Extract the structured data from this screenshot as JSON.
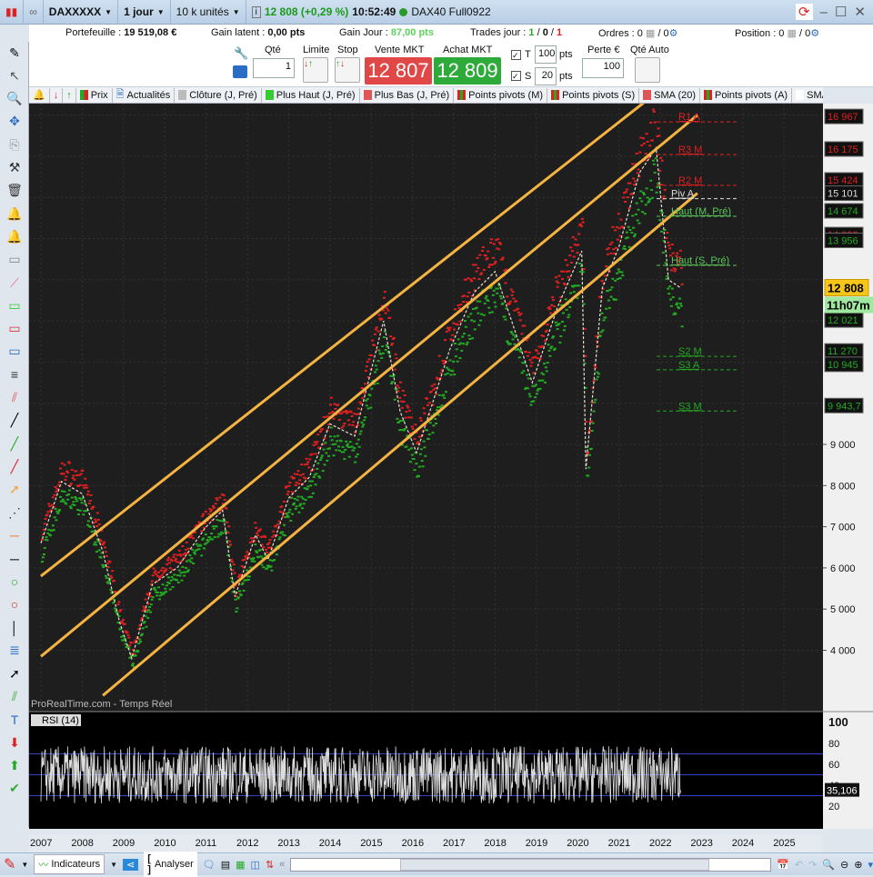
{
  "titlebar": {
    "symbol": "DAXXXXX",
    "period": "1 jour",
    "units": "10 k unités",
    "quote": "12 808 (+0,29 %)",
    "time": "10:52:49",
    "instrument": "DAX40 Full0922"
  },
  "infobar": {
    "portefeuille_label": "Portefeuille :",
    "portefeuille": "19 519,08 €",
    "gain_latent_label": "Gain latent :",
    "gain_latent": "0,00 pts",
    "gain_jour_label": "Gain Jour :",
    "gain_jour": "87,00 pts",
    "trades_label": "Trades jour :",
    "trades_a": "1",
    "trades_b": "0",
    "trades_c": "1",
    "ordres_label": "Ordres : 0",
    "ordres_b": "/ 0",
    "position_label": "Position : 0",
    "position_b": "/ 0"
  },
  "trade": {
    "qte_label": "Qté",
    "qte": "1",
    "limite_label": "Limite",
    "stop_label": "Stop",
    "vente_label": "Vente MKT",
    "vente": "12 807",
    "achat_label": "Achat MKT",
    "achat": "12 809",
    "t_label": "T",
    "t_value": "100",
    "s_label": "S",
    "s_value": "20",
    "pts": "pts",
    "perte_label": "Perte €",
    "perte": "100",
    "qte_auto_label": "Qté Auto"
  },
  "legend": [
    "Prix",
    "Actualités",
    "Clôture (J, Pré)",
    "Plus Haut (J, Pré)",
    "Plus Bas (J, Pré)",
    "Points pivots (M)",
    "Points pivots (S)",
    "SMA (20)",
    "Points pivots (A)",
    "SMA ("
  ],
  "colors": {
    "up": "#22aa22",
    "down": "#e02020",
    "channel": "#f5b342",
    "background": "#1e1e1e",
    "vente": "#e04848",
    "achat": "#2eaa3a"
  },
  "chart": {
    "watermark": "ProRealTime.com - Temps Réel",
    "pivot_labels": [
      {
        "t": "R1 A",
        "p": 16967,
        "c": "#e02020"
      },
      {
        "t": "R3 M",
        "p": 16175,
        "c": "#e02020"
      },
      {
        "t": "R2 M",
        "p": 15424,
        "c": "#e02020"
      },
      {
        "t": "Piv A",
        "p": 15101,
        "c": "#dddddd"
      },
      {
        "t": "Haut (M, Pré)",
        "p": 14674,
        "c": "#5ac85a"
      },
      {
        "t": "Haut (S, Pré)",
        "p": 13480,
        "c": "#5ac85a"
      },
      {
        "t": "S2 M",
        "p": 11270,
        "c": "#22aa22"
      },
      {
        "t": "S3 A",
        "p": 10945,
        "c": "#22aa22"
      },
      {
        "t": "S3 M",
        "p": 9943.7,
        "c": "#22aa22"
      }
    ],
    "price_tags": [
      {
        "t": "16 967",
        "c": "#e02020"
      },
      {
        "t": "16 175",
        "c": "#e02020"
      },
      {
        "t": "15 424",
        "c": "#e02020"
      },
      {
        "t": "15 101",
        "c": "#dddddd"
      },
      {
        "t": "14 674",
        "c": "#22aa22"
      },
      {
        "t": "14 098",
        "c": "#e02020"
      },
      {
        "t": "13 956",
        "c": "#22aa22"
      },
      {
        "t": "12 021",
        "c": "#22aa22"
      },
      {
        "t": "11 270",
        "c": "#22aa22"
      },
      {
        "t": "10 945",
        "c": "#22aa22"
      },
      {
        "t": "9 943,7",
        "c": "#22aa22"
      }
    ],
    "last_price": "12 808",
    "countdown": "11h07m",
    "rsi_label": "RSI (14)",
    "rsi_value": "35,106"
  },
  "chart_data": {
    "type": "line",
    "ylim": [
      3000,
      17500
    ],
    "yticks": [
      "4 000",
      "5 000",
      "6 000",
      "7 000",
      "8 000",
      "9 000"
    ],
    "xticks": [
      "2007",
      "2008",
      "2009",
      "2010",
      "2011",
      "2012",
      "2013",
      "2014",
      "2015",
      "2016",
      "2017",
      "2018",
      "2019",
      "2020",
      "2021",
      "2022",
      "2023",
      "2024",
      "2025"
    ],
    "price": [
      [
        2007.0,
        6600
      ],
      [
        2007.5,
        8100
      ],
      [
        2008.0,
        7800
      ],
      [
        2008.5,
        6400
      ],
      [
        2008.9,
        4700
      ],
      [
        2009.2,
        3800
      ],
      [
        2009.7,
        5600
      ],
      [
        2010.3,
        6000
      ],
      [
        2011.0,
        7000
      ],
      [
        2011.4,
        7400
      ],
      [
        2011.7,
        5300
      ],
      [
        2012.2,
        6800
      ],
      [
        2012.5,
        6200
      ],
      [
        2013.0,
        7700
      ],
      [
        2013.5,
        8200
      ],
      [
        2014.0,
        9500
      ],
      [
        2014.6,
        9200
      ],
      [
        2015.3,
        12000
      ],
      [
        2015.7,
        9800
      ],
      [
        2016.1,
        8800
      ],
      [
        2016.9,
        11300
      ],
      [
        2017.5,
        12700
      ],
      [
        2018.0,
        13200
      ],
      [
        2018.9,
        10500
      ],
      [
        2019.5,
        12300
      ],
      [
        2020.1,
        13700
      ],
      [
        2020.2,
        8400
      ],
      [
        2020.6,
        12800
      ],
      [
        2021.0,
        13800
      ],
      [
        2021.5,
        15600
      ],
      [
        2021.9,
        16200
      ],
      [
        2022.2,
        13000
      ],
      [
        2022.5,
        12800
      ]
    ],
    "channel": [
      [
        [
          2007.0,
          5800
        ],
        [
          2021.6,
          17300
        ]
      ],
      [
        [
          2007.0,
          3850
        ],
        [
          2022.9,
          17000
        ]
      ],
      [
        [
          2008.5,
          2900
        ],
        [
          2022.9,
          15101
        ]
      ]
    ],
    "rsi": {
      "levels": [
        30,
        50,
        70
      ],
      "ylim": [
        10,
        105
      ],
      "yticks": [
        "20",
        "40",
        "60",
        "80",
        "100"
      ],
      "last": 35.106
    }
  },
  "bottombar": {
    "indicateurs": "Indicateurs",
    "analyser": "Analyser"
  }
}
